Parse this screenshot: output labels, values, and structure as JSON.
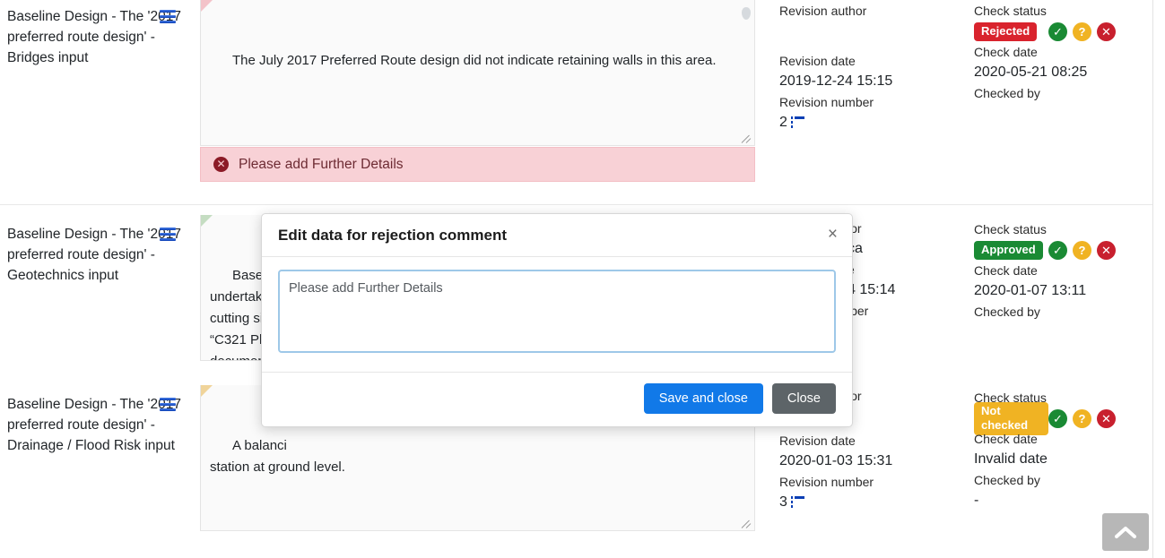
{
  "rows": [
    {
      "title": "Baseline Design - The '2017 preferred route design' - Bridges input",
      "menu_icon": "hamburger-icon",
      "comment": "The July 2017 Preferred Route design did not indicate retaining walls in this area.",
      "flag_color": "#f3c3c9",
      "error": {
        "icon": "error-circle-icon",
        "text": "Please add Further Details"
      },
      "revision_author_label": "Revision author",
      "revision_author": "",
      "revision_date_label": "Revision date",
      "revision_date": "2019-12-24 15:15",
      "revision_number_label": "Revision number",
      "revision_number": "2",
      "check_status_label": "Check status",
      "check_status": "Rejected",
      "check_status_color": "#d9232d",
      "check_date_label": "Check date",
      "check_date": "2020-05-21 08:25",
      "checked_by_label": "Checked by",
      "checked_by": ""
    },
    {
      "title": "Baseline Design - The '2017 preferred route design' - Geotechnics input",
      "menu_icon": "hamburger-icon",
      "comment": "Based on\nundertak\ncutting si\n“C321 Ph\ndocumen",
      "flag_color": "#c5ddc2",
      "error": null,
      "revision_author_label": "ior",
      "revision_author": "ca",
      "revision_date_label": "e",
      "revision_date": "4 15:14",
      "revision_number_label": "iber",
      "revision_number": "",
      "check_status_label": "Check status",
      "check_status": "Approved",
      "check_status_color": "#1a8a34",
      "check_date_label": "Check date",
      "check_date": "2020-01-07 13:11",
      "checked_by_label": "Checked by",
      "checked_by": ""
    },
    {
      "title": "Baseline Design - The '2017 preferred route design' - Drainage / Flood Risk input",
      "menu_icon": "hamburger-icon",
      "comment": "A balanci\nstation at ground level.",
      "flag_color": "#f0d49a",
      "error": null,
      "revision_author_label": "ior",
      "revision_author": "",
      "revision_date_label": "Revision date",
      "revision_date": "2020-01-03 15:31",
      "revision_number_label": "Revision number",
      "revision_number": "3",
      "check_status_label": "Check status",
      "check_status": "Not checked",
      "check_status_color": "#f0b323",
      "check_date_label": "Check date",
      "check_date": "Invalid date",
      "checked_by_label": "Checked by",
      "checked_by": "-"
    }
  ],
  "actions": {
    "approve": "approve-check-icon",
    "query": "query-check-icon",
    "reject": "reject-check-icon"
  },
  "modal": {
    "title": "Edit data for rejection comment",
    "close_icon": "close-icon",
    "textarea_value": "Please add Further Details",
    "textarea_placeholder": "Please add Further Details",
    "save_label": "Save and close",
    "close_label": "Close"
  },
  "scroll_top": {
    "icon": "chevron-up-icon"
  }
}
